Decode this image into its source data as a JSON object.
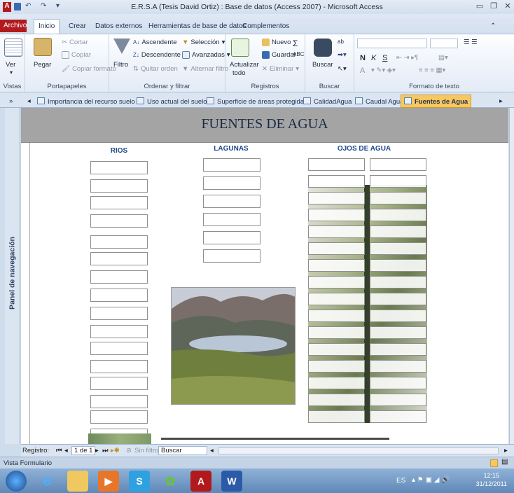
{
  "window": {
    "title": "E.R.S.A (Tesis David Ortiz) : Base de datos (Access 2007)  -  Microsoft Access",
    "app_glyph": "A"
  },
  "ribbon_tabs": [
    "Archivo",
    "Inicio",
    "Crear",
    "Datos externos",
    "Herramientas de base de datos",
    "Complementos"
  ],
  "ribbon": {
    "vistas": {
      "ver": "Ver",
      "label": "Vistas"
    },
    "portapapeles": {
      "pegar": "Pegar",
      "cortar": "Cortar",
      "copiar": "Copiar",
      "copiar_formato": "Copiar formato",
      "label": "Portapapeles"
    },
    "ordenar": {
      "filtro": "Filtro",
      "ascendente": "Ascendente",
      "descendente": "Descendente",
      "quitar_orden": "Quitar orden",
      "seleccion": "Selección",
      "avanzadas": "Avanzadas",
      "alternar_filtro": "Alternar filtro",
      "label": "Ordenar y filtrar"
    },
    "registros": {
      "actualizar": "Actualizar",
      "todo": "todo",
      "nuevo": "Nuevo",
      "guardar": "Guardar",
      "eliminar": "Eliminar",
      "label": "Registros"
    },
    "buscar": {
      "buscar": "Buscar",
      "label": "Buscar"
    },
    "formato": {
      "n": "N",
      "k": "K",
      "s": "S",
      "a": "A",
      "label": "Formato de texto"
    }
  },
  "doc_tabs": [
    {
      "label": "Importancia del recurso suelo",
      "active": false
    },
    {
      "label": "Uso actual del suelo",
      "active": false
    },
    {
      "label": "Superficie de áreas protegidas",
      "active": false
    },
    {
      "label": "CalidadAgua",
      "active": false
    },
    {
      "label": "Caudal Agua",
      "active": false
    },
    {
      "label": "Fuentes de Agua",
      "active": true
    }
  ],
  "nav_pane": {
    "label": "Panel de navegación",
    "toggle": "»"
  },
  "form": {
    "title": "FUENTES DE AGUA",
    "col_rios": "RIOS",
    "col_lagunas": "LAGUNAS",
    "col_ojos": "OJOS DE AGUA",
    "rios_count": 17,
    "lagunas_count": 6,
    "ojos_rows": 16
  },
  "record_bar": {
    "label": "Registro:",
    "position": "1 de 1",
    "filter": "Sin filtro",
    "search": "Buscar"
  },
  "status": {
    "text": "Vista Formulario"
  },
  "taskbar": {
    "lang": "ES",
    "time": "12:15",
    "date": "31/12/2011"
  }
}
